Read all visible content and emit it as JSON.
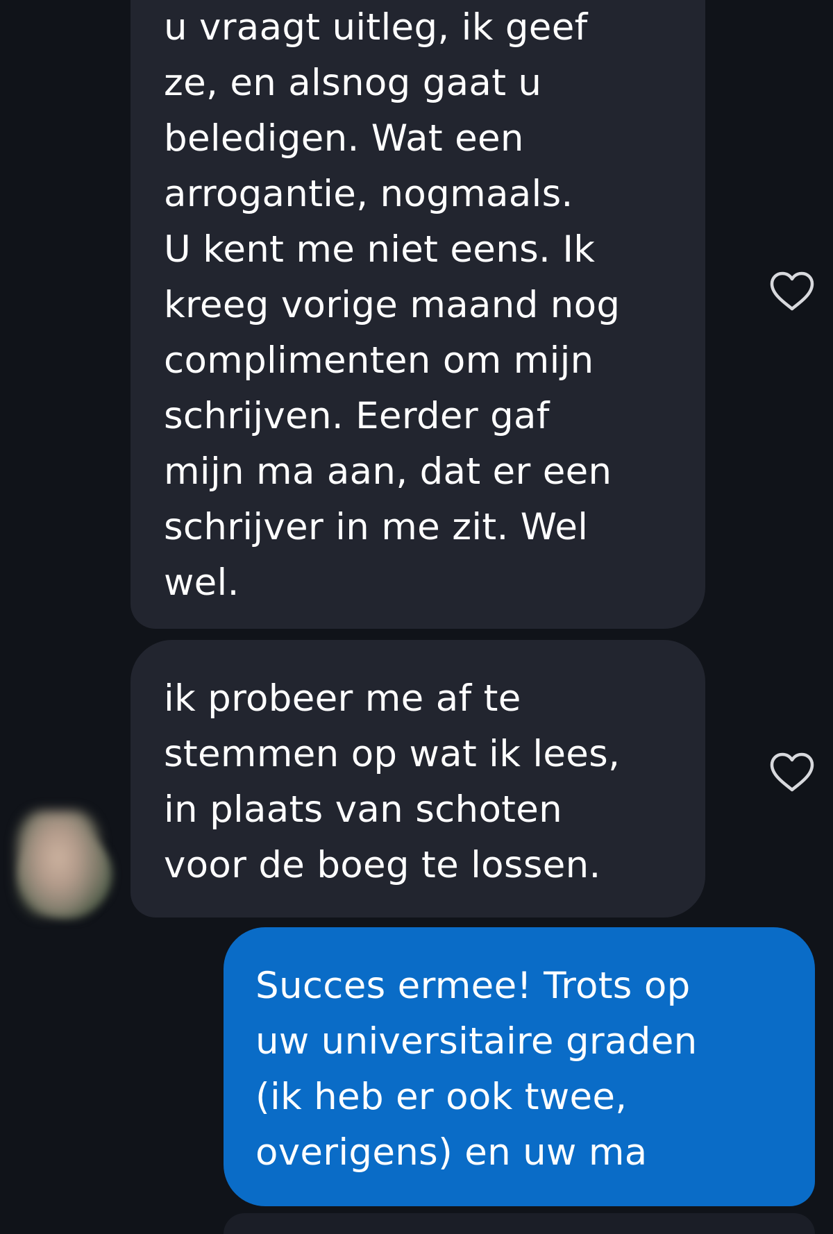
{
  "conversation": {
    "messages": [
      {
        "direction": "incoming",
        "lines": [
          "u vraagt uitleg, ik geef",
          "ze, en alsnog gaat u",
          "beledigen. Wat een",
          "arrogantie, nogmaals.",
          "U kent me niet eens. Ik",
          "kreeg vorige maand nog",
          "complimenten om mijn",
          "schrijven. Eerder gaf",
          "mijn ma aan, dat er een",
          "schrijver in me zit. Wel",
          "wel."
        ],
        "reaction_icon": "heart-outline-icon"
      },
      {
        "direction": "incoming",
        "lines": [
          "ik probeer me af te",
          "stemmen op wat ik lees,",
          "in plaats van schoten",
          "voor de boeg te lossen."
        ],
        "reaction_icon": "heart-outline-icon"
      },
      {
        "direction": "outgoing",
        "lines": [
          "Succes ermee! Trots op",
          "uw universitaire graden",
          "(ik heb er ook twee,",
          "overigens) en uw ma"
        ]
      }
    ],
    "avatar": "blurred-contact-photo"
  },
  "colors": {
    "background": "#101319",
    "incoming_bubble": "#22252f",
    "outgoing_bubble": "#0a6cc7",
    "text": "#ffffff",
    "heart_outline": "#d8d9dd"
  }
}
